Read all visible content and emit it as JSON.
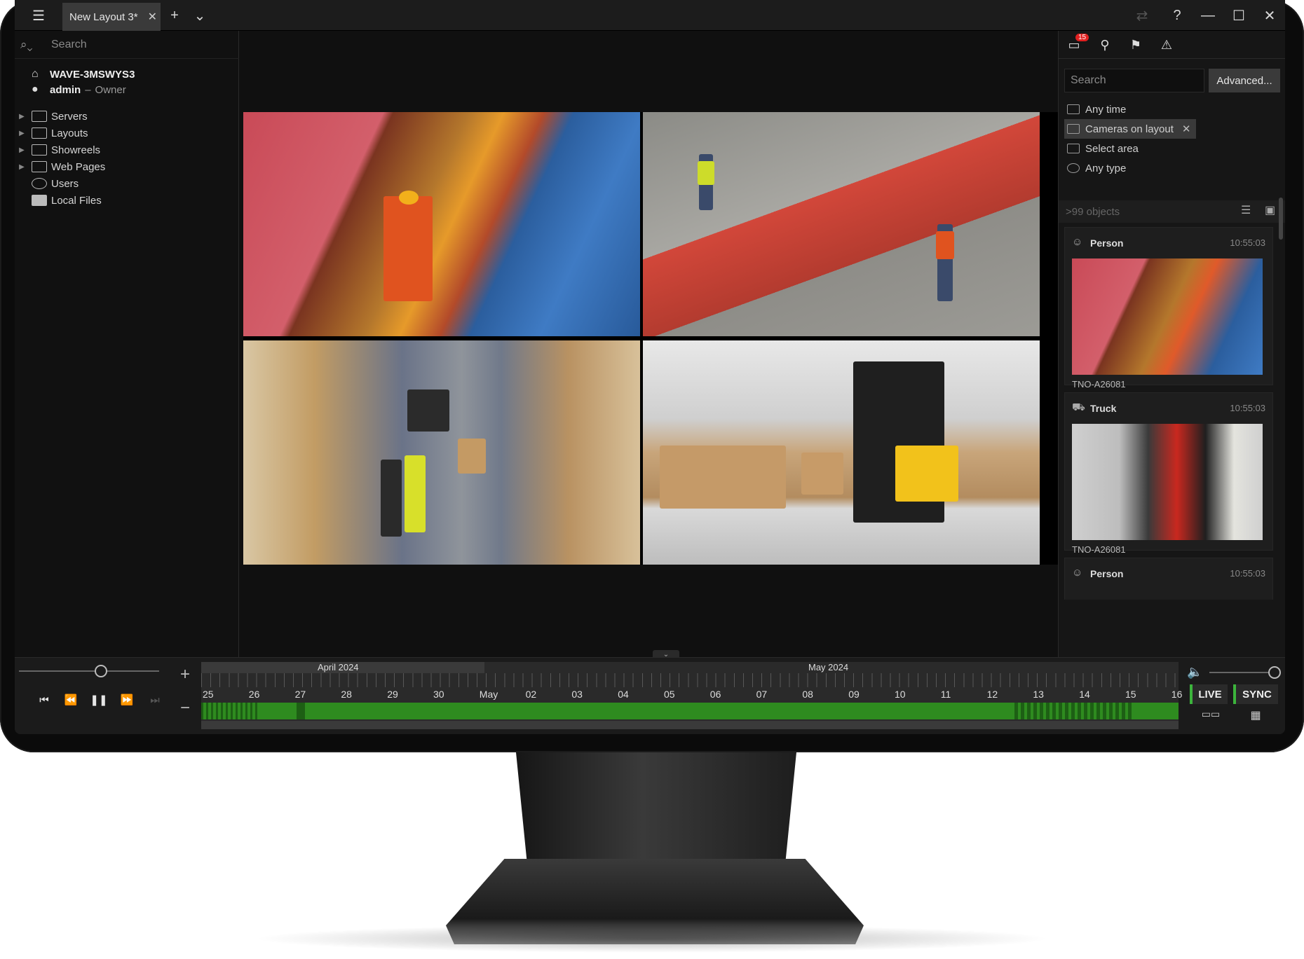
{
  "titlebar": {
    "tab_label": "New Layout 3*",
    "tab_close": "✕",
    "add_tab": "+",
    "tab_menu": "⌄",
    "help": "?",
    "minimize": "—",
    "maximize": "☐",
    "close": "✕"
  },
  "left": {
    "search_placeholder": "Search",
    "system_name": "WAVE-3MSWYS3",
    "user_name": "admin",
    "user_role": "Owner",
    "tree": [
      "Servers",
      "Layouts",
      "Showreels",
      "Web Pages",
      "Users",
      "Local Files"
    ]
  },
  "right": {
    "notification_count": "15",
    "search_placeholder": "Search",
    "advanced_label": "Advanced...",
    "filters": {
      "time": "Any time",
      "cameras": "Cameras on layout",
      "area": "Select area",
      "type": "Any type"
    },
    "results_count": ">99 objects",
    "cards": [
      {
        "type": "Person",
        "time": "10:55:03",
        "camera": "TNO-A26081"
      },
      {
        "type": "Truck",
        "time": "10:55:03",
        "camera": "TNO-A26081"
      },
      {
        "type": "Person",
        "time": "10:55:03"
      }
    ]
  },
  "timeline": {
    "months": [
      "April 2024",
      "May 2024"
    ],
    "days": [
      "25",
      "26",
      "27",
      "28",
      "29",
      "30",
      "May",
      "02",
      "03",
      "04",
      "05",
      "06",
      "07",
      "08",
      "09",
      "10",
      "11",
      "12",
      "13",
      "14",
      "15",
      "16"
    ],
    "live_label": "LIVE",
    "sync_label": "SYNC",
    "zoom_in": "+",
    "zoom_out": "−"
  },
  "colors": {
    "accent_green": "#3cb43c",
    "recording_green": "#2e8b1f",
    "notification_red": "#e02020"
  }
}
